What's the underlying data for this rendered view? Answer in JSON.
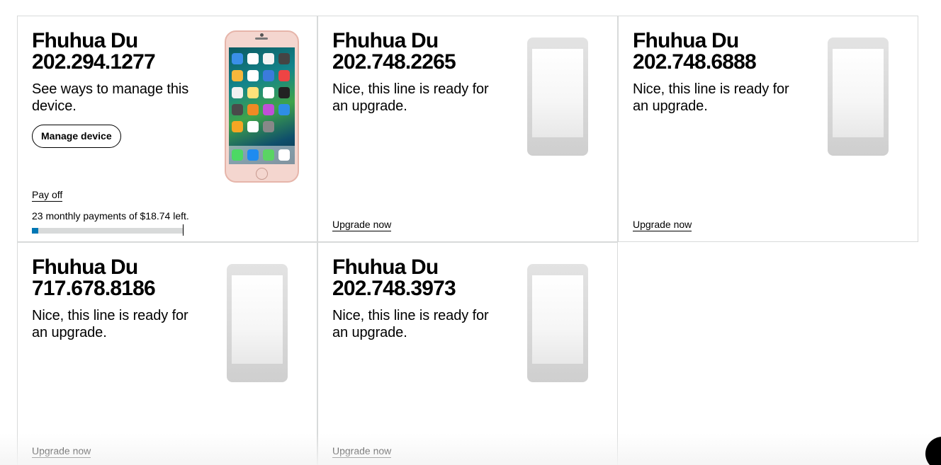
{
  "lines": [
    {
      "name": "Fhuhua Du",
      "number": "202.294.1277",
      "description": "See ways to manage this device.",
      "button_label": "Manage device",
      "link_label": "Pay off",
      "payments_text": "23 monthly payments of $18.74 left.",
      "progress_fraction": 0.04,
      "device_icon": "iphone-rose-gold-image"
    },
    {
      "name": "Fhuhua Du",
      "number": "202.748.2265",
      "description": "Nice, this line is ready for an upgrade.",
      "link_label": "Upgrade now",
      "device_icon": "phone-placeholder-icon"
    },
    {
      "name": "Fhuhua Du",
      "number": "202.748.6888",
      "description": "Nice, this line is ready for an upgrade.",
      "link_label": "Upgrade now",
      "device_icon": "phone-placeholder-icon"
    },
    {
      "name": "Fhuhua Du",
      "number": "717.678.8186",
      "description": "Nice, this line is ready for an upgrade.",
      "link_label": "Upgrade now",
      "device_icon": "phone-placeholder-icon"
    },
    {
      "name": "Fhuhua Du",
      "number": "202.748.3973",
      "description": "Nice, this line is ready for an upgrade.",
      "link_label": "Upgrade now",
      "device_icon": "phone-placeholder-icon"
    }
  ],
  "colors": {
    "progress_fill": "#0077b4",
    "progress_track": "#d8dada",
    "card_border": "#d8dada"
  },
  "chat_icon": "chat-bubble-icon"
}
